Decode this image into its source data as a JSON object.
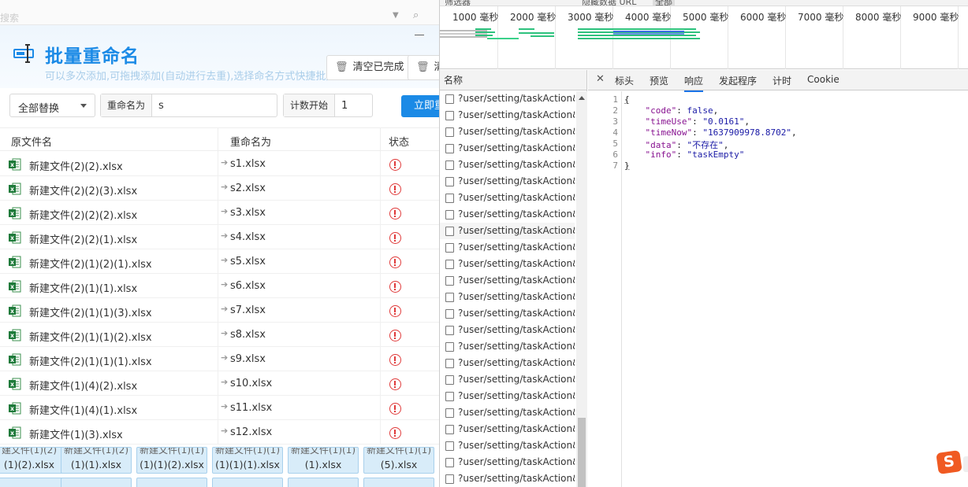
{
  "dialog": {
    "top_placeholder": "搜索",
    "title": "批量重命名",
    "subtitle": "可以多次添加,可拖拽添加(自动进行去重),选择命名方式快捷批处理",
    "clear_done_label": "清空已完成",
    "clear_label": "清",
    "mode_select": "全部替换",
    "rename_label": "重命名为",
    "rename_value": "s",
    "count_label": "计数开始",
    "count_value": "1",
    "start_button": "立即重命名",
    "columns": [
      "原文件名",
      "重命名为",
      "状态"
    ],
    "rows": [
      {
        "orig": "新建文件(2)(2).xlsx",
        "new": "s1.xlsx"
      },
      {
        "orig": "新建文件(2)(2)(3).xlsx",
        "new": "s2.xlsx"
      },
      {
        "orig": "新建文件(2)(2)(2).xlsx",
        "new": "s3.xlsx"
      },
      {
        "orig": "新建文件(2)(2)(1).xlsx",
        "new": "s4.xlsx"
      },
      {
        "orig": "新建文件(2)(1)(2)(1).xlsx",
        "new": "s5.xlsx"
      },
      {
        "orig": "新建文件(2)(1)(1).xlsx",
        "new": "s6.xlsx"
      },
      {
        "orig": "新建文件(2)(1)(1)(3).xlsx",
        "new": "s7.xlsx"
      },
      {
        "orig": "新建文件(2)(1)(1)(2).xlsx",
        "new": "s8.xlsx"
      },
      {
        "orig": "新建文件(2)(1)(1)(1).xlsx",
        "new": "s9.xlsx"
      },
      {
        "orig": "新建文件(1)(4)(2).xlsx",
        "new": "s10.xlsx"
      },
      {
        "orig": "新建文件(1)(4)(1).xlsx",
        "new": "s11.xlsx"
      },
      {
        "orig": "新建文件(1)(3).xlsx",
        "new": "s12.xlsx"
      }
    ],
    "tiles": [
      {
        "top": "建文件(1)(2)",
        "bottom": "(1)(2).xlsx"
      },
      {
        "top": "新建文件(1)(2)",
        "bottom": "(1)(1).xlsx"
      },
      {
        "top": "新建文件(1)(1)",
        "bottom": "(1)(1)(2).xlsx"
      },
      {
        "top": "新建文件(1)(1)",
        "bottom": "(1)(1)(1).xlsx"
      },
      {
        "top": "新建文件(1)(1)",
        "bottom": "(1).xlsx"
      },
      {
        "top": "新建文件(1)(1)",
        "bottom": "(5).xlsx"
      }
    ]
  },
  "devtools": {
    "timeline_ticks": [
      "1000 毫秒",
      "2000 毫秒",
      "3000 毫秒",
      "4000 毫秒",
      "5000 毫秒",
      "6000 毫秒",
      "7000 毫秒",
      "8000 毫秒",
      "9000 毫秒"
    ],
    "names_header": "名称",
    "request_name": "?user/setting/taskAction&action=getTask",
    "request_count": 24,
    "tabs": [
      "标头",
      "预览",
      "响应",
      "发起程序",
      "计时",
      "Cookie"
    ],
    "active_tab": "响应",
    "response_lines": [
      "{",
      "    \"code\": false,",
      "    \"timeUse\": \"0.0161\",",
      "    \"timeNow\": \"1637909978.8702\",",
      "    \"data\": \"不存在\",",
      "    \"info\": \"taskEmpty\"",
      "}"
    ],
    "response": {
      "code": "false",
      "timeUse": "\"0.0161\"",
      "timeNow": "\"1637909978.8702\"",
      "data": "\"不存在\"",
      "info": "\"taskEmpty\""
    }
  },
  "colors": {
    "accent": "#1b8ae6",
    "error": "#e03a3a",
    "sogou": "#f05a22"
  }
}
